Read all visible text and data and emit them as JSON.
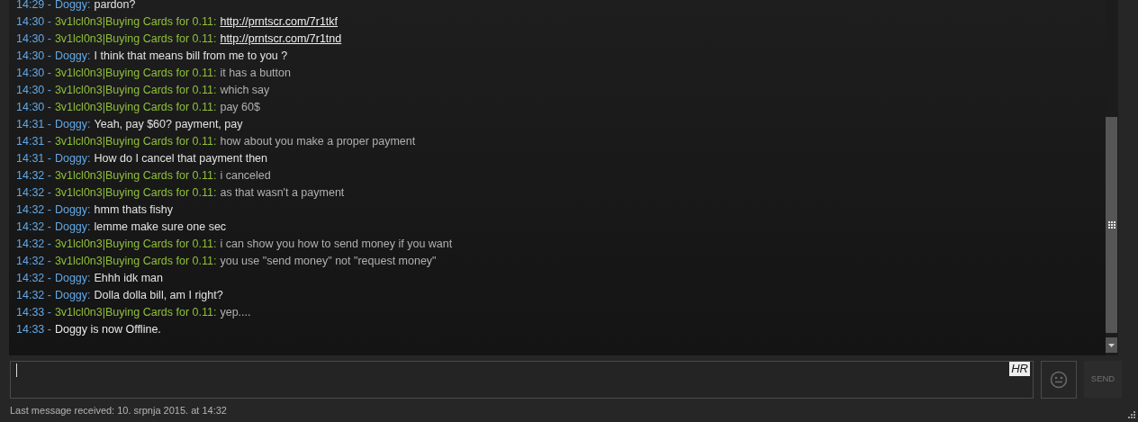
{
  "messages": [
    {
      "time": "14:29 -",
      "sender": "Doggy:",
      "kind": "friend",
      "text": "pardon?",
      "is_link": false
    },
    {
      "time": "14:30 -",
      "sender": "3v1lcl0n3|Buying Cards for 0.11:",
      "kind": "self",
      "text": "http://prntscr.com/7r1tkf",
      "is_link": true
    },
    {
      "time": "14:30 -",
      "sender": "3v1lcl0n3|Buying Cards for 0.11:",
      "kind": "self",
      "text": "http://prntscr.com/7r1tnd",
      "is_link": true
    },
    {
      "time": "14:30 -",
      "sender": "Doggy:",
      "kind": "friend",
      "text": "I think that means bill from me to you ?",
      "is_link": false
    },
    {
      "time": "14:30 -",
      "sender": "3v1lcl0n3|Buying Cards for 0.11:",
      "kind": "self",
      "text": "it has a button",
      "is_link": false
    },
    {
      "time": "14:30 -",
      "sender": "3v1lcl0n3|Buying Cards for 0.11:",
      "kind": "self",
      "text": "which say",
      "is_link": false
    },
    {
      "time": "14:30 -",
      "sender": "3v1lcl0n3|Buying Cards for 0.11:",
      "kind": "self",
      "text": "pay 60$",
      "is_link": false
    },
    {
      "time": "14:31 -",
      "sender": "Doggy:",
      "kind": "friend",
      "text": "Yeah, pay $60? payment, pay",
      "is_link": false
    },
    {
      "time": "14:31 -",
      "sender": "3v1lcl0n3|Buying Cards for 0.11:",
      "kind": "self",
      "text": "how about you make a proper payment",
      "is_link": false
    },
    {
      "time": "14:31 -",
      "sender": "Doggy:",
      "kind": "friend",
      "text": "How do I cancel that payment then",
      "is_link": false
    },
    {
      "time": "14:32 -",
      "sender": "3v1lcl0n3|Buying Cards for 0.11:",
      "kind": "self",
      "text": "i canceled",
      "is_link": false
    },
    {
      "time": "14:32 -",
      "sender": "3v1lcl0n3|Buying Cards for 0.11:",
      "kind": "self",
      "text": "as that wasn't a payment",
      "is_link": false
    },
    {
      "time": "14:32 -",
      "sender": "Doggy:",
      "kind": "friend",
      "text": "hmm thats fishy",
      "is_link": false
    },
    {
      "time": "14:32 -",
      "sender": "Doggy:",
      "kind": "friend",
      "text": "lemme make sure one sec",
      "is_link": false
    },
    {
      "time": "14:32 -",
      "sender": "3v1lcl0n3|Buying Cards for 0.11:",
      "kind": "self",
      "text": "i can show you how to send money if you want",
      "is_link": false
    },
    {
      "time": "14:32 -",
      "sender": "3v1lcl0n3|Buying Cards for 0.11:",
      "kind": "self",
      "text": "you use \"send money\" not \"request money\"",
      "is_link": false
    },
    {
      "time": "14:32 -",
      "sender": "Doggy:",
      "kind": "friend",
      "text": "Ehhh idk man",
      "is_link": false
    },
    {
      "time": "14:32 -",
      "sender": "Doggy:",
      "kind": "friend",
      "text": "Dolla dolla bill, am I right?",
      "is_link": false
    },
    {
      "time": "14:33 -",
      "sender": "3v1lcl0n3|Buying Cards for 0.11:",
      "kind": "self",
      "text": "yep....",
      "is_link": false
    }
  ],
  "system_message": {
    "time": "14:33 -",
    "text": "Doggy is now Offline."
  },
  "input": {
    "language": "HR"
  },
  "send_button": "SEND",
  "footer": "Last message received: 10. srpnja 2015. at 14:32"
}
